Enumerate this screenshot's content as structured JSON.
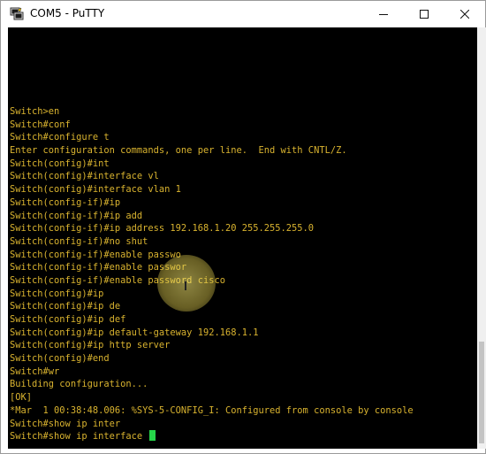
{
  "window": {
    "title": "COM5 - PuTTY",
    "icon": "putty-icon",
    "controls": {
      "minimize_icon": "minimize-icon",
      "maximize_icon": "maximize-icon",
      "close_icon": "close-icon"
    }
  },
  "colors": {
    "terminal_bg": "#000000",
    "terminal_text": "#d9b32f",
    "cursor": "#26d64a",
    "highlight": "#f0e070"
  },
  "terminal": {
    "lines": [
      "Switch>en",
      "Switch#conf",
      "Switch#configure t",
      "Enter configuration commands, one per line.  End with CNTL/Z.",
      "Switch(config)#int",
      "Switch(config)#interface vl",
      "Switch(config)#interface vlan 1",
      "Switch(config-if)#ip",
      "Switch(config-if)#ip add",
      "Switch(config-if)#ip address 192.168.1.20 255.255.255.0",
      "Switch(config-if)#no shut",
      "Switch(config-if)#enable passwo",
      "Switch(config-if)#enable passwor",
      "Switch(config-if)#enable password cisco",
      "Switch(config)#ip",
      "Switch(config)#ip de",
      "Switch(config)#ip def",
      "Switch(config)#ip default-gateway 192.168.1.1",
      "Switch(config)#ip http server",
      "Switch(config)#end",
      "Switch#wr",
      "Building configuration...",
      "[OK]",
      "*Mar  1 00:38:48.006: %SYS-5-CONFIG_I: Configured from console by console",
      "Switch#show ip inter",
      "Switch#show ip interface "
    ]
  }
}
